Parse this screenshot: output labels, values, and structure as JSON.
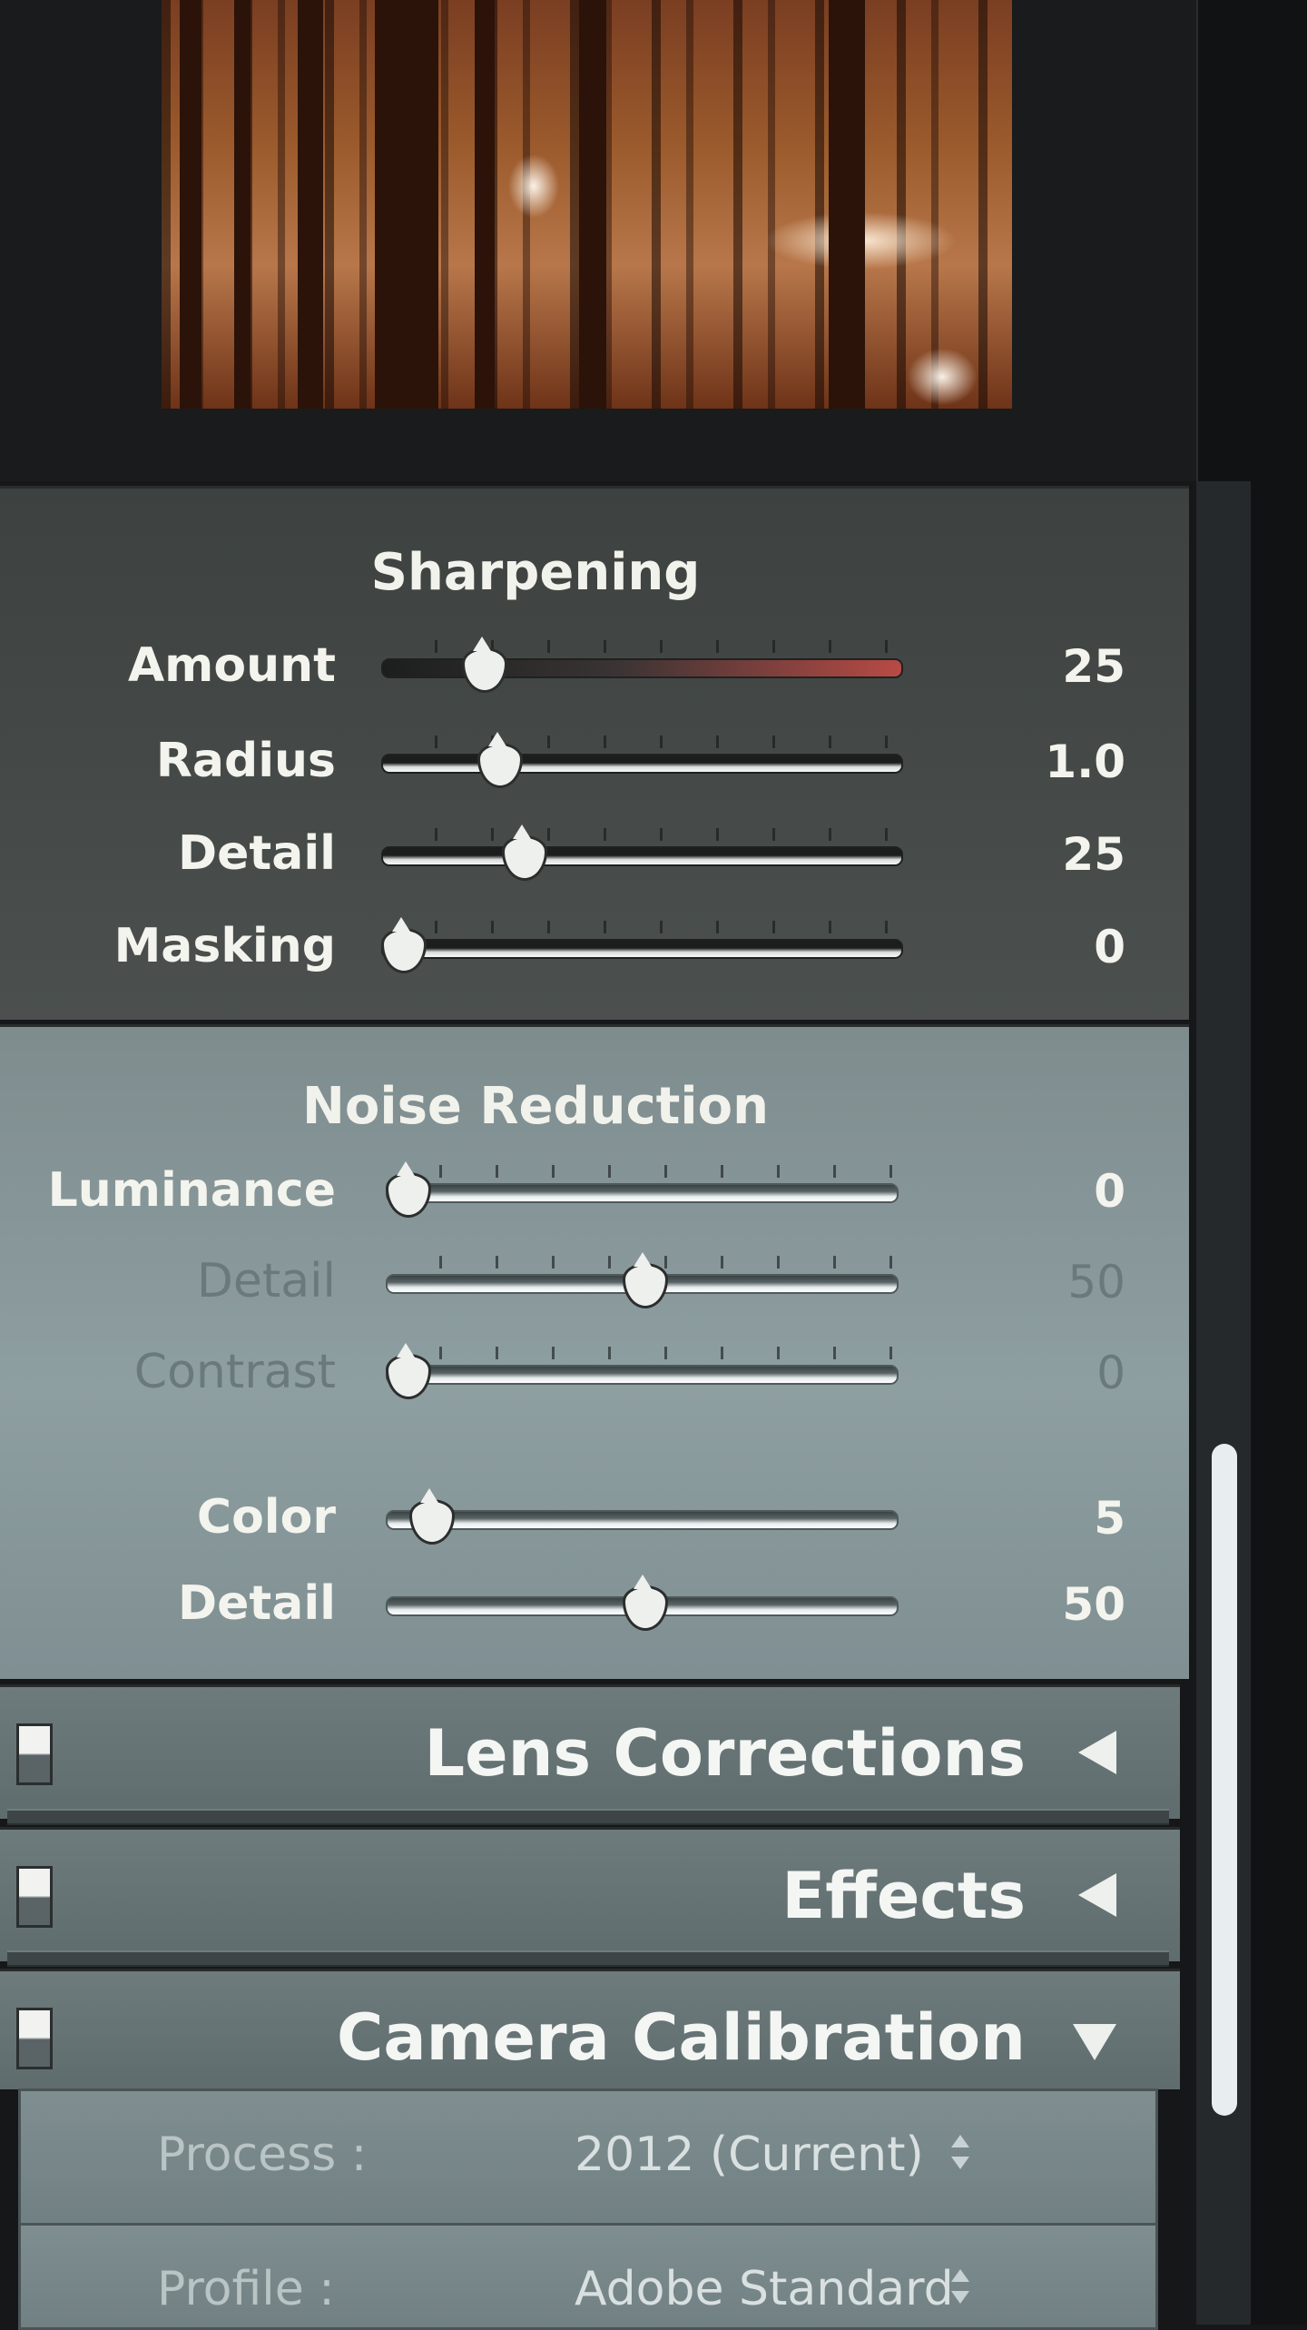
{
  "sharpening": {
    "title": "Sharpening",
    "rows": [
      {
        "label": "Amount",
        "value": "25",
        "position": 0.168
      },
      {
        "label": "Radius",
        "value": "1.0",
        "position": 0.2
      },
      {
        "label": "Detail",
        "value": "25",
        "position": 0.25
      },
      {
        "label": "Masking",
        "value": "0",
        "position": 0.0
      }
    ]
  },
  "noise_reduction": {
    "title": "Noise Reduction",
    "rows": [
      {
        "label": "Luminance",
        "value": "0",
        "position": 0.0,
        "enabled": true
      },
      {
        "label": "Detail",
        "value": "50",
        "position": 0.5,
        "enabled": false
      },
      {
        "label": "Contrast",
        "value": "0",
        "position": 0.0,
        "enabled": false
      },
      {
        "label": "Color",
        "value": "5",
        "position": 0.05,
        "enabled": true
      },
      {
        "label": "Detail",
        "value": "50",
        "position": 0.5,
        "enabled": true
      }
    ]
  },
  "collapsed_panels": [
    {
      "title": "Lens Corrections",
      "state": "collapsed"
    },
    {
      "title": "Effects",
      "state": "collapsed"
    },
    {
      "title": "Camera Calibration",
      "state": "expanded"
    }
  ],
  "camera_calibration": {
    "process_label": "Process :",
    "process_value": "2012 (Current)",
    "profile_label": "Profile :",
    "profile_value": "Adobe Standard"
  },
  "colors": {
    "amount_track_accent": "#b84a44",
    "panel_dark": "#3d4240",
    "panel_light": "#8e9fa1"
  }
}
